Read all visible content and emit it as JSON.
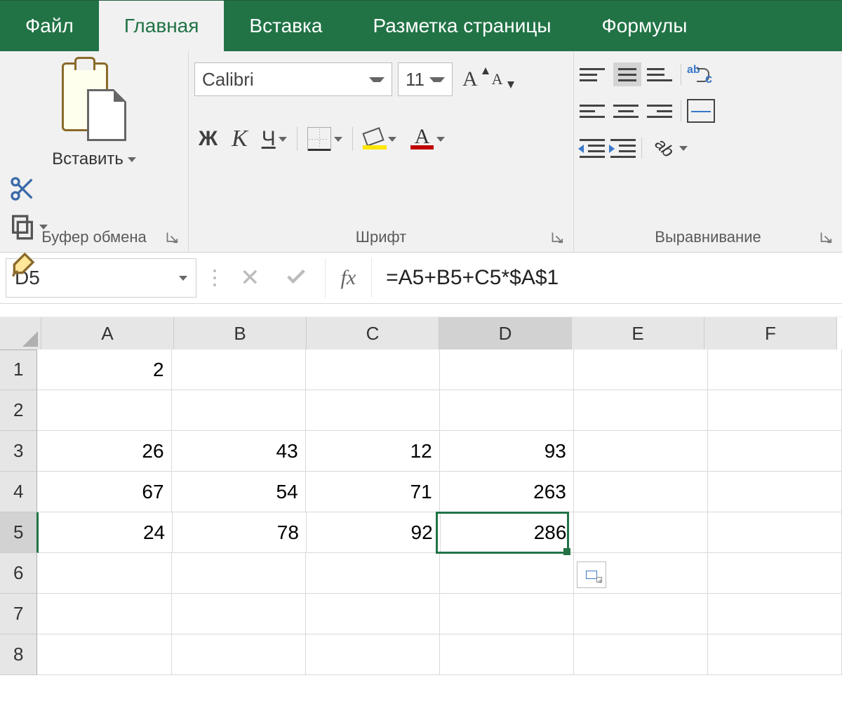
{
  "tabs": {
    "file": "Файл",
    "home": "Главная",
    "insert": "Вставка",
    "layout": "Разметка страницы",
    "formulas": "Формулы"
  },
  "ribbon": {
    "clipboard": {
      "paste": "Вставить",
      "group_label": "Буфер обмена"
    },
    "font": {
      "name": "Calibri",
      "size": "11",
      "bold": "Ж",
      "italic": "К",
      "underline": "Ч",
      "fontcolor_letter": "А",
      "size_inc_letter": "A",
      "size_dec_letter": "A",
      "group_label": "Шрифт"
    },
    "alignment": {
      "orient_text": "ab",
      "wrap_a": "ab",
      "wrap_b": "c",
      "group_label": "Выравнивание"
    }
  },
  "formula_bar": {
    "name_box": "D5",
    "fx": "fx",
    "formula": "=A5+B5+C5*$A$1"
  },
  "sheet": {
    "columns": [
      "A",
      "B",
      "C",
      "D",
      "E",
      "F"
    ],
    "selected_col": "D",
    "selected_row": 5,
    "rows": [
      {
        "n": 1,
        "A": "2",
        "B": "",
        "C": "",
        "D": "",
        "E": "",
        "F": ""
      },
      {
        "n": 2,
        "A": "",
        "B": "",
        "C": "",
        "D": "",
        "E": "",
        "F": ""
      },
      {
        "n": 3,
        "A": "26",
        "B": "43",
        "C": "12",
        "D": "93",
        "E": "",
        "F": ""
      },
      {
        "n": 4,
        "A": "67",
        "B": "54",
        "C": "71",
        "D": "263",
        "E": "",
        "F": ""
      },
      {
        "n": 5,
        "A": "24",
        "B": "78",
        "C": "92",
        "D": "286",
        "E": "",
        "F": ""
      },
      {
        "n": 6,
        "A": "",
        "B": "",
        "C": "",
        "D": "",
        "E": "",
        "F": ""
      },
      {
        "n": 7,
        "A": "",
        "B": "",
        "C": "",
        "D": "",
        "E": "",
        "F": ""
      },
      {
        "n": 8,
        "A": "",
        "B": "",
        "C": "",
        "D": "",
        "E": "",
        "F": ""
      }
    ]
  },
  "chart_data": {
    "type": "table",
    "title": "",
    "columns": [
      "A",
      "B",
      "C",
      "D"
    ],
    "rows": [
      {
        "row": 1,
        "A": 2,
        "B": null,
        "C": null,
        "D": null
      },
      {
        "row": 3,
        "A": 26,
        "B": 43,
        "C": 12,
        "D": 93
      },
      {
        "row": 4,
        "A": 67,
        "B": 54,
        "C": 71,
        "D": 263
      },
      {
        "row": 5,
        "A": 24,
        "B": 78,
        "C": 92,
        "D": 286
      }
    ],
    "active_cell": "D5",
    "active_formula": "=A5+B5+C5*$A$1"
  }
}
